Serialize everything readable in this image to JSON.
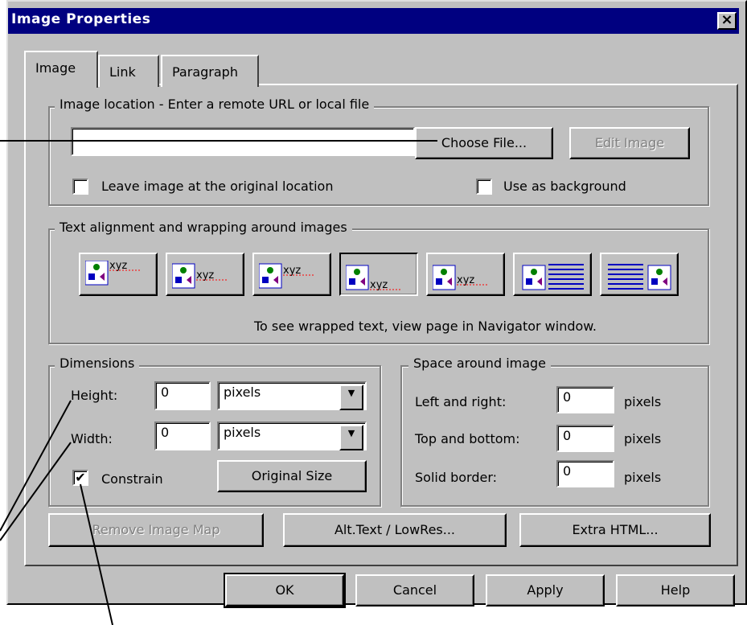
{
  "window": {
    "title": "Image Properties",
    "close_glyph": "×"
  },
  "tabs": [
    {
      "label": "Image",
      "active": true
    },
    {
      "label": "Link",
      "active": false
    },
    {
      "label": "Paragraph",
      "active": false
    }
  ],
  "location": {
    "legend": "Image location - Enter a remote URL or local file",
    "url_value": "",
    "choose_file": "Choose File...",
    "edit_image": "Edit Image",
    "leave_original": "Leave image at the original location",
    "use_background": "Use as background"
  },
  "alignment": {
    "legend": "Text alignment and wrapping around images",
    "sample_text": "xyz",
    "note": "To see wrapped text, view page in Navigator window.",
    "buttons": [
      {
        "name": "align-top"
      },
      {
        "name": "align-center"
      },
      {
        "name": "align-middle"
      },
      {
        "name": "align-baseline"
      },
      {
        "name": "align-bottom"
      },
      {
        "name": "wrap-left"
      },
      {
        "name": "wrap-right"
      }
    ]
  },
  "dimensions": {
    "legend": "Dimensions",
    "height_label": "Height:",
    "height_value": "0",
    "height_unit": "pixels",
    "width_label": "Width:",
    "width_value": "0",
    "width_unit": "pixels",
    "constrain_label": "Constrain",
    "constrain_checked_glyph": "✔",
    "original_size": "Original Size"
  },
  "space": {
    "legend": "Space around image",
    "left_right_label": "Left and right:",
    "left_right_value": "0",
    "top_bottom_label": "Top and bottom:",
    "top_bottom_value": "0",
    "border_label": "Solid border:",
    "border_value": "0",
    "unit": "pixels"
  },
  "bottom_buttons": {
    "remove_map": "Remove Image Map",
    "alt_text": "Alt.Text / LowRes...",
    "extra_html": "Extra HTML..."
  },
  "dialog_buttons": {
    "ok": "OK",
    "cancel": "Cancel",
    "apply": "Apply",
    "help": "Help"
  },
  "colors": {
    "dialog_bg": "#c0c0c0",
    "title_bg": "#000080",
    "icon_blue": "#0000c0",
    "icon_green": "#008000",
    "icon_purple": "#800080",
    "text_red": "#ff0000"
  }
}
